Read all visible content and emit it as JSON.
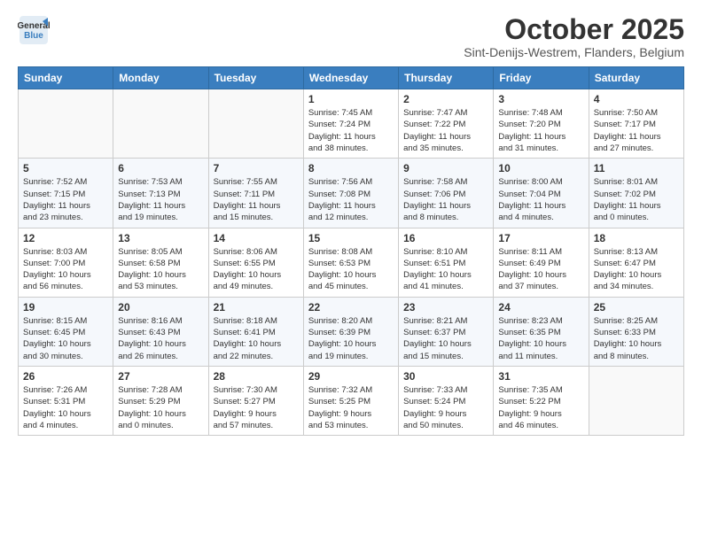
{
  "header": {
    "logo_line1": "General",
    "logo_line2": "Blue",
    "month_title": "October 2025",
    "subtitle": "Sint-Denijs-Westrem, Flanders, Belgium"
  },
  "weekdays": [
    "Sunday",
    "Monday",
    "Tuesday",
    "Wednesday",
    "Thursday",
    "Friday",
    "Saturday"
  ],
  "weeks": [
    [
      {
        "day": "",
        "info": ""
      },
      {
        "day": "",
        "info": ""
      },
      {
        "day": "",
        "info": ""
      },
      {
        "day": "1",
        "info": "Sunrise: 7:45 AM\nSunset: 7:24 PM\nDaylight: 11 hours\nand 38 minutes."
      },
      {
        "day": "2",
        "info": "Sunrise: 7:47 AM\nSunset: 7:22 PM\nDaylight: 11 hours\nand 35 minutes."
      },
      {
        "day": "3",
        "info": "Sunrise: 7:48 AM\nSunset: 7:20 PM\nDaylight: 11 hours\nand 31 minutes."
      },
      {
        "day": "4",
        "info": "Sunrise: 7:50 AM\nSunset: 7:17 PM\nDaylight: 11 hours\nand 27 minutes."
      }
    ],
    [
      {
        "day": "5",
        "info": "Sunrise: 7:52 AM\nSunset: 7:15 PM\nDaylight: 11 hours\nand 23 minutes."
      },
      {
        "day": "6",
        "info": "Sunrise: 7:53 AM\nSunset: 7:13 PM\nDaylight: 11 hours\nand 19 minutes."
      },
      {
        "day": "7",
        "info": "Sunrise: 7:55 AM\nSunset: 7:11 PM\nDaylight: 11 hours\nand 15 minutes."
      },
      {
        "day": "8",
        "info": "Sunrise: 7:56 AM\nSunset: 7:08 PM\nDaylight: 11 hours\nand 12 minutes."
      },
      {
        "day": "9",
        "info": "Sunrise: 7:58 AM\nSunset: 7:06 PM\nDaylight: 11 hours\nand 8 minutes."
      },
      {
        "day": "10",
        "info": "Sunrise: 8:00 AM\nSunset: 7:04 PM\nDaylight: 11 hours\nand 4 minutes."
      },
      {
        "day": "11",
        "info": "Sunrise: 8:01 AM\nSunset: 7:02 PM\nDaylight: 11 hours\nand 0 minutes."
      }
    ],
    [
      {
        "day": "12",
        "info": "Sunrise: 8:03 AM\nSunset: 7:00 PM\nDaylight: 10 hours\nand 56 minutes."
      },
      {
        "day": "13",
        "info": "Sunrise: 8:05 AM\nSunset: 6:58 PM\nDaylight: 10 hours\nand 53 minutes."
      },
      {
        "day": "14",
        "info": "Sunrise: 8:06 AM\nSunset: 6:55 PM\nDaylight: 10 hours\nand 49 minutes."
      },
      {
        "day": "15",
        "info": "Sunrise: 8:08 AM\nSunset: 6:53 PM\nDaylight: 10 hours\nand 45 minutes."
      },
      {
        "day": "16",
        "info": "Sunrise: 8:10 AM\nSunset: 6:51 PM\nDaylight: 10 hours\nand 41 minutes."
      },
      {
        "day": "17",
        "info": "Sunrise: 8:11 AM\nSunset: 6:49 PM\nDaylight: 10 hours\nand 37 minutes."
      },
      {
        "day": "18",
        "info": "Sunrise: 8:13 AM\nSunset: 6:47 PM\nDaylight: 10 hours\nand 34 minutes."
      }
    ],
    [
      {
        "day": "19",
        "info": "Sunrise: 8:15 AM\nSunset: 6:45 PM\nDaylight: 10 hours\nand 30 minutes."
      },
      {
        "day": "20",
        "info": "Sunrise: 8:16 AM\nSunset: 6:43 PM\nDaylight: 10 hours\nand 26 minutes."
      },
      {
        "day": "21",
        "info": "Sunrise: 8:18 AM\nSunset: 6:41 PM\nDaylight: 10 hours\nand 22 minutes."
      },
      {
        "day": "22",
        "info": "Sunrise: 8:20 AM\nSunset: 6:39 PM\nDaylight: 10 hours\nand 19 minutes."
      },
      {
        "day": "23",
        "info": "Sunrise: 8:21 AM\nSunset: 6:37 PM\nDaylight: 10 hours\nand 15 minutes."
      },
      {
        "day": "24",
        "info": "Sunrise: 8:23 AM\nSunset: 6:35 PM\nDaylight: 10 hours\nand 11 minutes."
      },
      {
        "day": "25",
        "info": "Sunrise: 8:25 AM\nSunset: 6:33 PM\nDaylight: 10 hours\nand 8 minutes."
      }
    ],
    [
      {
        "day": "26",
        "info": "Sunrise: 7:26 AM\nSunset: 5:31 PM\nDaylight: 10 hours\nand 4 minutes."
      },
      {
        "day": "27",
        "info": "Sunrise: 7:28 AM\nSunset: 5:29 PM\nDaylight: 10 hours\nand 0 minutes."
      },
      {
        "day": "28",
        "info": "Sunrise: 7:30 AM\nSunset: 5:27 PM\nDaylight: 9 hours\nand 57 minutes."
      },
      {
        "day": "29",
        "info": "Sunrise: 7:32 AM\nSunset: 5:25 PM\nDaylight: 9 hours\nand 53 minutes."
      },
      {
        "day": "30",
        "info": "Sunrise: 7:33 AM\nSunset: 5:24 PM\nDaylight: 9 hours\nand 50 minutes."
      },
      {
        "day": "31",
        "info": "Sunrise: 7:35 AM\nSunset: 5:22 PM\nDaylight: 9 hours\nand 46 minutes."
      },
      {
        "day": "",
        "info": ""
      }
    ]
  ]
}
